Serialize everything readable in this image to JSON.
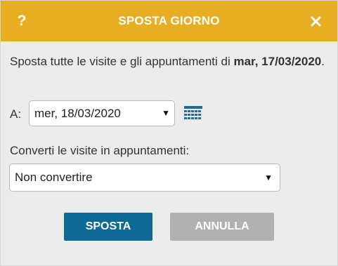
{
  "dialog": {
    "title": "SPOSTA GIORNO",
    "help_label": "?",
    "close_icon": "close-icon",
    "accent_color": "#e7ae21"
  },
  "description": {
    "text_before": "Sposta tutte le visite e gli appuntamenti di ",
    "date_bold": "mar, 17/03/2020",
    "text_after": "."
  },
  "target_date": {
    "label": "A:",
    "value": "mer, 18/03/2020",
    "calendar_icon": "calendar-icon"
  },
  "convert": {
    "label": "Converti le visite in appuntamenti:",
    "value": "Non convertire"
  },
  "buttons": {
    "move_label": "SPOSTA",
    "move_color": "#0d6a95",
    "cancel_label": "ANNULLA",
    "cancel_color": "#b1b1b1"
  }
}
